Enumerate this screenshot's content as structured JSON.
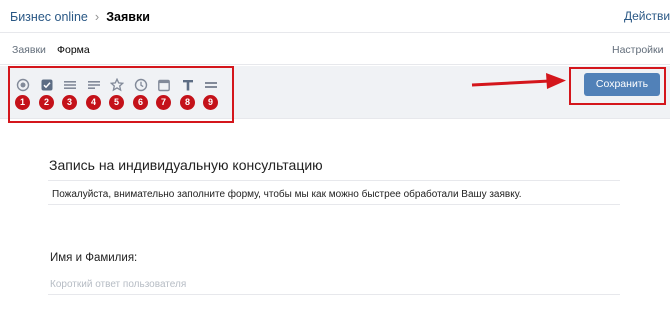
{
  "header": {
    "breadcrumb_root": "Бизнес online",
    "breadcrumb_sep": "›",
    "breadcrumb_current": "Заявки",
    "actions_label": "Действия"
  },
  "tabs": {
    "requests": "Заявки",
    "form": "Форма",
    "settings": "Настройки"
  },
  "toolbar": {
    "tools": [
      {
        "icon": "radio-icon",
        "number": "1"
      },
      {
        "icon": "checkbox-icon",
        "number": "2"
      },
      {
        "icon": "paragraph-icon",
        "number": "3"
      },
      {
        "icon": "short-text-icon",
        "number": "4"
      },
      {
        "icon": "star-rating-icon",
        "number": "5"
      },
      {
        "icon": "clock-icon",
        "number": "6"
      },
      {
        "icon": "calendar-icon",
        "number": "7"
      },
      {
        "icon": "text-icon",
        "number": "8"
      },
      {
        "icon": "section-icon",
        "number": "9"
      }
    ],
    "save_label": "Сохранить"
  },
  "form": {
    "title": "Запись на индивидуальную консультацию",
    "description": "Пожалуйста, внимательно заполните форму, чтобы мы как можно быстрее обработали Вашу заявку.",
    "question_label": "Имя и Фамилия:",
    "answer_placeholder": "Короткий ответ пользователя"
  },
  "colors": {
    "accent": "#5181b8",
    "link": "#2a5885",
    "annotation_red": "#d4161c",
    "toolbar_bg": "#f0f2f5"
  }
}
